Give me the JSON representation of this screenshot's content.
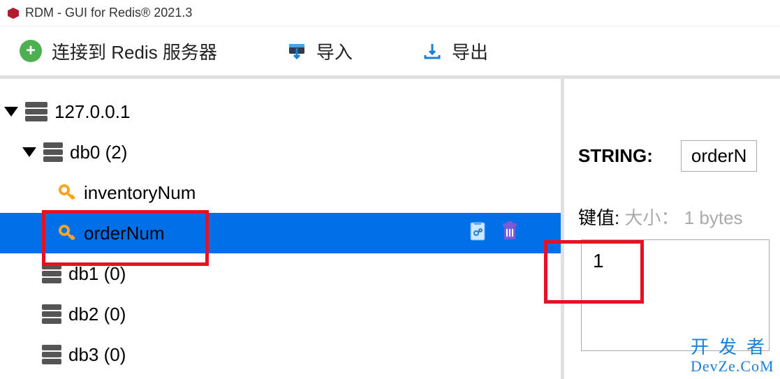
{
  "window": {
    "title": "RDM - GUI for Redis® 2021.3"
  },
  "toolbar": {
    "connect_label": "连接到 Redis 服务器",
    "import_label": "导入",
    "export_label": "导出"
  },
  "tree": {
    "server_label": "127.0.0.1",
    "db0_label": "db0  (2)",
    "keys": [
      {
        "label": "inventoryNum"
      },
      {
        "label": "orderNum"
      }
    ],
    "other_dbs": [
      "db1  (0)",
      "db2  (0)",
      "db3  (0)"
    ]
  },
  "detail": {
    "type_label": "STRING:",
    "key_name": "orderN",
    "kv_label": "键值:",
    "size_label": "大小：",
    "size_value": "1 bytes",
    "value": "1"
  },
  "watermark": {
    "cn": "开发者",
    "en": "DevZe.CoM"
  }
}
